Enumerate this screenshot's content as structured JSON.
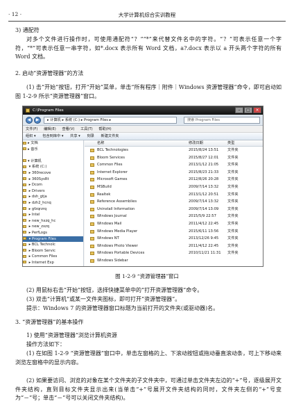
{
  "header": {
    "page_number": "· 12 ·",
    "book_title": "大学计算机综合实训教程"
  },
  "section3": {
    "heading": "3) 通配符",
    "body": "对多个文件进行操作时，可使用通配符“？”“*”来代替文件名中的字符。“？”可表示任意一个字符，“*”可表示任意一串字符，如*.docx 表示所有 Word 文档，a?.docx 表示以 a 开头两个字符的所有 Word 文档。"
  },
  "section2": {
    "heading": "2. 启动“资源管理器”的方法",
    "step1": "(1) 击“开始”按钮，打开“开始”菜单，单击“所有程序｜附件｜Windows 资源管理器”命令，即可启动如图 1-2-9 所示“资源管理器”窗口。"
  },
  "screenshot": {
    "window_title": "C:\\Program Files",
    "address": "▸ 计算机 ▸ 系统 (C:) ▸ Program Files ▸",
    "search_placeholder": "搜索 Program Files",
    "menu": [
      "文件(F)",
      "编辑(E)",
      "查看(V)",
      "工具(T)",
      "帮助(H)"
    ],
    "toolbar": [
      "组织 ▾",
      "包含到库中 ▾",
      "共享 ▾",
      "刻录",
      "新建文件夹"
    ],
    "nav": [
      {
        "label": "▸ 文档",
        "selected": false
      },
      {
        "label": "▸ 音乐",
        "selected": false
      },
      {
        "label": "",
        "selected": false
      },
      {
        "label": "▾ 计算机",
        "selected": false
      },
      {
        "label": "  ▾ 系统 (C:)",
        "selected": false
      },
      {
        "label": "    ▸ 360recove",
        "selected": false
      },
      {
        "label": "    ▸ 360SysRt",
        "selected": false
      },
      {
        "label": "    ▸ Dcom",
        "selected": false
      },
      {
        "label": "    ▸ Drivers",
        "selected": false
      },
      {
        "label": "    ▸ dsh_gtja",
        "selected": false
      },
      {
        "label": "    ▸ dzh2_hcnq",
        "selected": false
      },
      {
        "label": "    ▸ gfzqrzrq",
        "selected": false
      },
      {
        "label": "    ▸ Intel",
        "selected": false
      },
      {
        "label": "    ▸ new_hxzq_hc",
        "selected": false
      },
      {
        "label": "    ▸ new_zxzq",
        "selected": false
      },
      {
        "label": "    ▸ PerfLogs",
        "selected": false
      },
      {
        "label": "    ▾ Program Files",
        "selected": true
      },
      {
        "label": "      ▸ BCL Technolc",
        "selected": false
      },
      {
        "label": "      ▸ Bloom Servic",
        "selected": false
      },
      {
        "label": "      ▸ Common Files",
        "selected": false
      },
      {
        "label": "      ▸ Internet Exp",
        "selected": false
      }
    ],
    "columns": {
      "name": "名称",
      "date": "修改日期",
      "type": "类型"
    },
    "files": [
      {
        "name": "BCL Technologies",
        "date": "2015/8/24 13:51",
        "type": "文件夹"
      },
      {
        "name": "Bloom Services",
        "date": "2015/8/27 12:01",
        "type": "文件夹"
      },
      {
        "name": "Common Files",
        "date": "2013/1/12 21:05",
        "type": "文件夹"
      },
      {
        "name": "Internet Explorer",
        "date": "2015/8/23 21:33",
        "type": "文件夹"
      },
      {
        "name": "Microsoft Games",
        "date": "2012/8/26 20:28",
        "type": "文件夹"
      },
      {
        "name": "MSBuild",
        "date": "2009/7/14 13:32",
        "type": "文件夹"
      },
      {
        "name": "Realtek",
        "date": "2013/1/12 20:51",
        "type": "文件夹"
      },
      {
        "name": "Reference Assemblies",
        "date": "2009/7/14 13:32",
        "type": "文件夹"
      },
      {
        "name": "Uninstall Information",
        "date": "2009/7/14 13:09",
        "type": "文件夹"
      },
      {
        "name": "Windows Journal",
        "date": "2015/5/9 22:57",
        "type": "文件夹"
      },
      {
        "name": "Windows Mail",
        "date": "2011/4/12 22:45",
        "type": "文件夹"
      },
      {
        "name": "Windows Media Player",
        "date": "2015/6/11 13:56",
        "type": "文件夹"
      },
      {
        "name": "Windows NT",
        "date": "2013/12/26 9:45",
        "type": "文件夹"
      },
      {
        "name": "Windows Photo Viewer",
        "date": "2011/4/12 22:45",
        "type": "文件夹"
      },
      {
        "name": "Windows Portable Devices",
        "date": "2010/11/21 11:31",
        "type": "文件夹"
      },
      {
        "name": "Windows Sidebar",
        "date": "",
        "type": ""
      }
    ]
  },
  "figure_caption": "图 1-2-9 “资源管理器”窗口",
  "after": {
    "step2": "(2) 用鼠标右击“开始”按钮，选择快捷菜单中的“打开资源管理器”命令。",
    "step3": "(3) 双击“计算机”或某一文件夹图标，即可打开“资源管理器”。",
    "note": "提示：Windows 7 的资源管理器窗口标题为当前打开的文件夹(或驱动器)名。"
  },
  "section3b": {
    "heading": "3. “资源管理器”的基本操作",
    "sub1": "1) 使用“资源管理器”浏览计算机资源",
    "steps_label": "操作方法如下：",
    "p1": "(1) 在如图 1-2-9 “资源管理器”窗口中，单击左窗格的上、下滚动按钮或拖动垂直滚动条，可上下移动来浏览左窗格中的显示内容。",
    "p2": "(2) 如果要访问、浏览的对象在某个文件夹的子文件夹中，可通过单击文件夹左边的“+”号，逐级展开文件夹结构，直到目标文件夹显示出来(当单击“+”号展开文件夹结构的同时，文件夹左侧的“+”号变为“－”号；单击“－”号可以关闭文件夹结构)。"
  }
}
